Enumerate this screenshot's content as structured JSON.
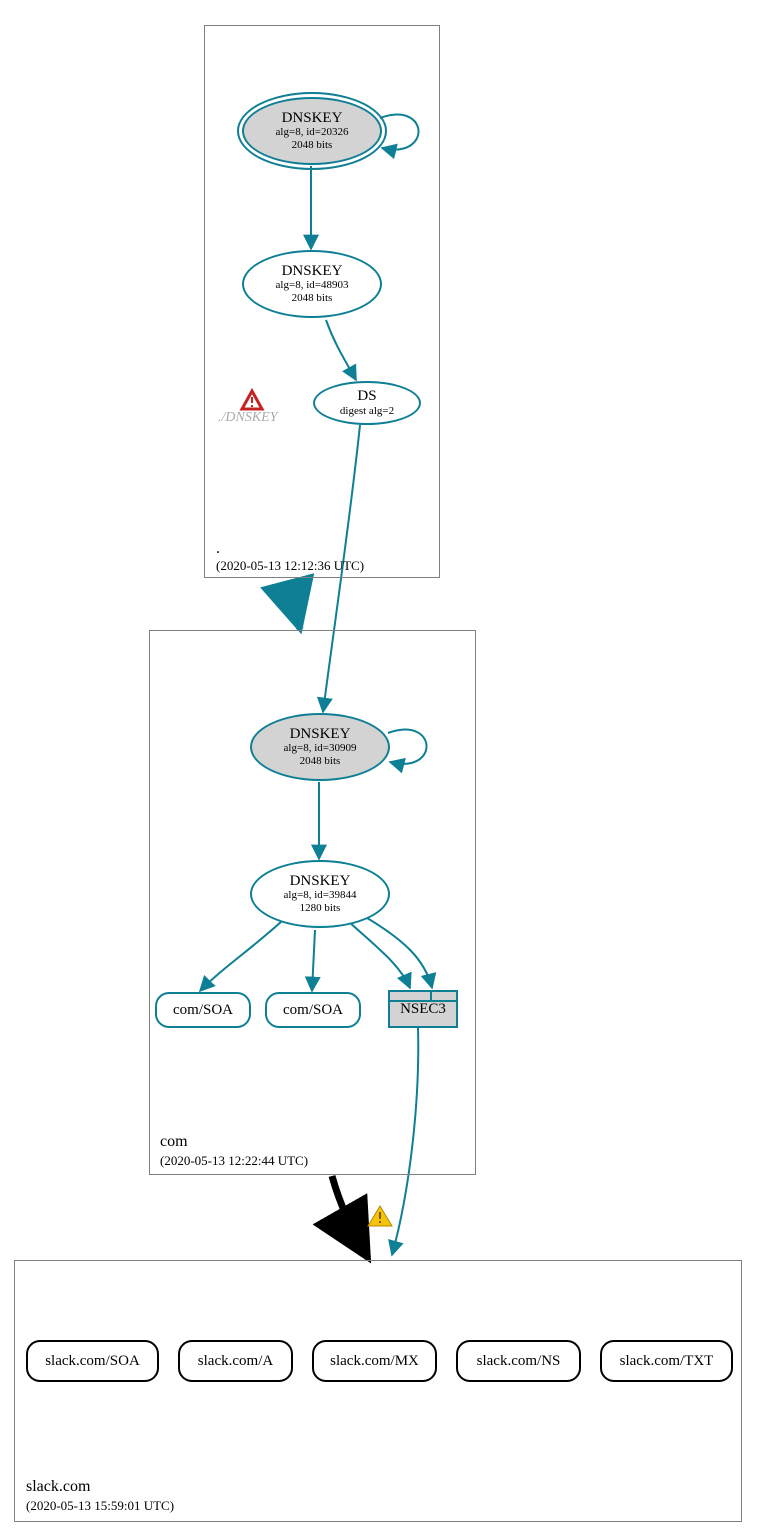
{
  "colors": {
    "teal": "#0e7f94",
    "grey_fill": "#d3d3d3",
    "black": "#000000",
    "phantom_grey": "#aaaaaa",
    "warn_yellow": "#f5c40a",
    "warn_red": "#c62222"
  },
  "zones": {
    "root": {
      "name": ".",
      "date": "(2020-05-13 12:12:36 UTC)"
    },
    "com": {
      "name": "com",
      "date": "(2020-05-13 12:22:44 UTC)"
    },
    "slack": {
      "name": "slack.com",
      "date": "(2020-05-13 15:59:01 UTC)"
    }
  },
  "nodes": {
    "root_ksk": {
      "title": "DNSKEY",
      "line2": "alg=8, id=20326",
      "line3": "2048 bits"
    },
    "root_zsk": {
      "title": "DNSKEY",
      "line2": "alg=8, id=48903",
      "line3": "2048 bits"
    },
    "root_ds": {
      "title": "DS",
      "line2": "digest alg=2"
    },
    "com_ksk": {
      "title": "DNSKEY",
      "line2": "alg=8, id=30909",
      "line3": "2048 bits"
    },
    "com_zsk": {
      "title": "DNSKEY",
      "line2": "alg=8, id=39844",
      "line3": "1280 bits"
    },
    "com_soa_1": "com/SOA",
    "com_soa_2": "com/SOA",
    "nsec3": "NSEC3",
    "phantom": "./DNSKEY",
    "slack_soa": "slack.com/SOA",
    "slack_a": "slack.com/A",
    "slack_mx": "slack.com/MX",
    "slack_ns": "slack.com/NS",
    "slack_txt": "slack.com/TXT"
  }
}
